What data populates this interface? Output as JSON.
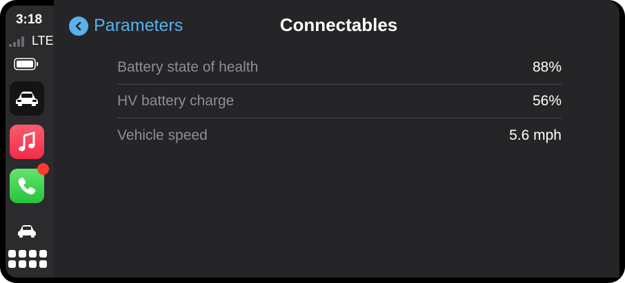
{
  "status_bar": {
    "time": "3:18",
    "network": "LTE"
  },
  "dock": {
    "apps": [
      {
        "icon": "car-app-icon"
      },
      {
        "icon": "music-app-icon"
      },
      {
        "icon": "phone-app-icon",
        "badge": true
      }
    ],
    "now_playing_icon": "car-icon",
    "home_icon": "app-grid-icon"
  },
  "nav": {
    "back_label": "Parameters",
    "title": "Connectables"
  },
  "rows": [
    {
      "label": "Battery state of health",
      "value": "88%"
    },
    {
      "label": "HV battery charge",
      "value": "56%"
    },
    {
      "label": "Vehicle speed",
      "value": "5.6 mph"
    }
  ],
  "colors": {
    "accent": "#5ab1ec",
    "background": "#252528",
    "dock": "#2b2b2e",
    "badge": "#ff3b30"
  }
}
